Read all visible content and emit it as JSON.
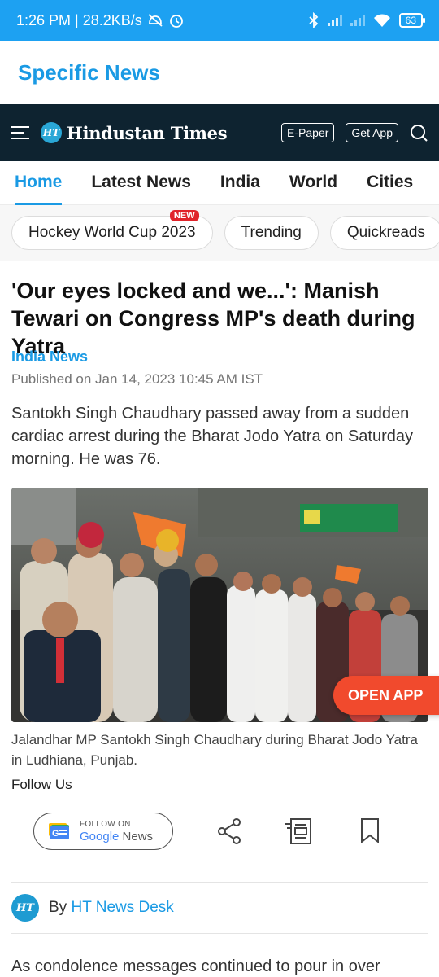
{
  "status_bar": {
    "time_speed": "1:26 PM | 28.2KB/s",
    "battery": "63"
  },
  "app_header": {
    "title": "Specific News"
  },
  "ht_nav": {
    "brand_badge": "HT",
    "brand_name": "Hindustan Times",
    "epaper_label": "E-Paper",
    "getapp_label": "Get App"
  },
  "tabs": [
    {
      "label": "Home",
      "active": true
    },
    {
      "label": "Latest News"
    },
    {
      "label": "India"
    },
    {
      "label": "World"
    },
    {
      "label": "Cities"
    }
  ],
  "chips": [
    {
      "label": "Hockey World Cup 2023",
      "badge": "NEW"
    },
    {
      "label": "Trending"
    },
    {
      "label": "Quickreads"
    }
  ],
  "article": {
    "headline": "'Our eyes locked and we...': Manish Tewari on Congress MP's death during Yatra",
    "section": "India News",
    "published": "Published on Jan 14, 2023 10:45 AM IST",
    "summary": "Santokh Singh Chaudhary passed away from a sudden cardiac arrest during the Bharat Jodo Yatra on Saturday morning. He was 76.",
    "caption": "Jalandhar MP Santokh Singh Chaudhary during Bharat Jodo Yatra in Ludhiana, Punjab.",
    "follow_us": "Follow Us",
    "author_prefix": "By",
    "author_name": "HT News Desk",
    "body_start": "As condolence messages continued to pour in over"
  },
  "open_app": {
    "label": "OPEN APP"
  },
  "google_news": {
    "follow_on": "FOLLOW ON",
    "google": "Google",
    "news": "News"
  },
  "colors": {
    "accent": "#1a9ae4",
    "navbar": "#0e2330",
    "status": "#1da1f2",
    "open_app": "#f14a2d",
    "badge": "#e0242a"
  }
}
